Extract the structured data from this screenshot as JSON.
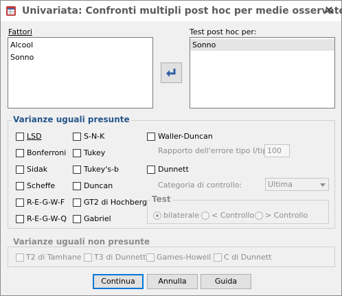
{
  "window": {
    "title": "Univariata: Confronti multipli post hoc per medie osservate",
    "close_glyph": "✕"
  },
  "factors": {
    "label": "Fattori",
    "items": [
      "Alcool",
      "Sonno"
    ]
  },
  "post_hoc": {
    "label": "Test post hoc per:",
    "items": [
      "Sonno"
    ]
  },
  "equal_variances": {
    "title": "Varianze uguali presunte",
    "col1": [
      "LSD",
      "Bonferroni",
      "Sidak",
      "Scheffe",
      "R-E-G-W-F",
      "R-E-G-W-Q"
    ],
    "col2": [
      "S-N-K",
      "Tukey",
      "Tukey's-b",
      "Duncan",
      "GT2 di Hochberg",
      "Gabriel"
    ],
    "waller_duncan": "Waller-Duncan",
    "error_ratio_label": "Rapporto dell'errore tipo I/tipo II:",
    "error_ratio_value": "100",
    "dunnett": "Dunnett",
    "control_category_label": "Categoria di controllo:",
    "control_category_value": "Ultima",
    "test": {
      "title": "Test",
      "options": [
        "bilaterale",
        "< Controllo",
        "> Controllo"
      ],
      "selected": "bilaterale"
    }
  },
  "unequal_variances": {
    "title": "Varianze uguali non presunte",
    "options": [
      "T2 di Tamhane",
      "T3 di Dunnett",
      "Games-Howell",
      "C di Dunnett"
    ]
  },
  "buttons": {
    "continue": "Continua",
    "cancel": "Annulla",
    "help": "Guida"
  },
  "colors": {
    "group_title": "#26578b",
    "default_button_border": "#0078d7",
    "dialog_background": "#f0f0f0"
  }
}
